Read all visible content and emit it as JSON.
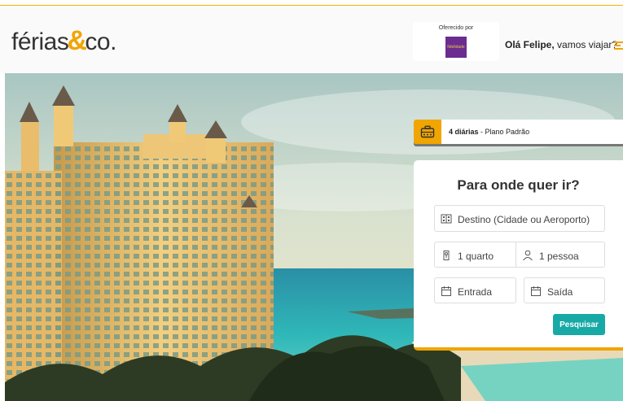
{
  "header": {
    "logo_part1": "férias",
    "logo_amp": "&",
    "logo_part2": "co.",
    "sponsor_label": "Oferecido por",
    "sponsor_logo_text": "fidelidade",
    "greeting_name": "Olá Felipe,",
    "greeting_text": " vamos viajar?"
  },
  "plan": {
    "nights": "4 diárias",
    "plan_name": " - Plano Padrão"
  },
  "search": {
    "title": "Para onde quer ir?",
    "destination_placeholder": "Destino (Cidade ou Aeroporto)",
    "rooms": "1 quarto",
    "guests": "1 pessoa",
    "checkin": "Entrada",
    "checkout": "Saída",
    "submit_label": "Pesquisar"
  },
  "colors": {
    "accent": "#f0a500",
    "button": "#17a9a6",
    "sponsor": "#6b2c8f"
  }
}
